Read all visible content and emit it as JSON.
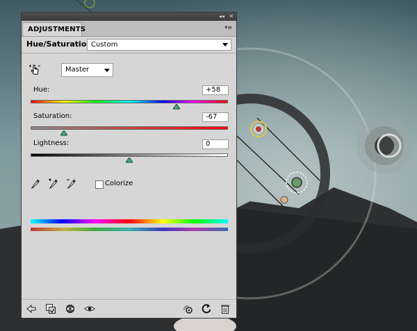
{
  "panel": {
    "tab_label": "ADJUSTMENTS",
    "header_title": "Hue/Saturation",
    "preset_value": "Custom",
    "channel_value": "Master",
    "colorize_label": "Colorize",
    "colorize_checked": false
  },
  "sliders": {
    "hue": {
      "label": "Hue:",
      "value": "+58",
      "position": 0.74
    },
    "saturation": {
      "label": "Saturation:",
      "value": "-67",
      "position": 0.17
    },
    "lightness": {
      "label": "Lightness:",
      "value": "0",
      "position": 0.5
    }
  },
  "icons": {
    "titlebar": [
      "collapse-icon",
      "close-icon"
    ],
    "tools": [
      "target-adjustment-icon",
      "eyedropper-icon",
      "eyedropper-plus-icon",
      "eyedropper-minus-icon"
    ],
    "bottom": [
      "back-arrow-icon",
      "clip-layer-icon",
      "visibility-toggle-icon",
      "eye-icon",
      "previous-state-icon",
      "reset-icon",
      "trash-icon"
    ]
  },
  "colors": {
    "panel_bg": "#d6d6d6",
    "titlebar_bg": "#444444"
  }
}
